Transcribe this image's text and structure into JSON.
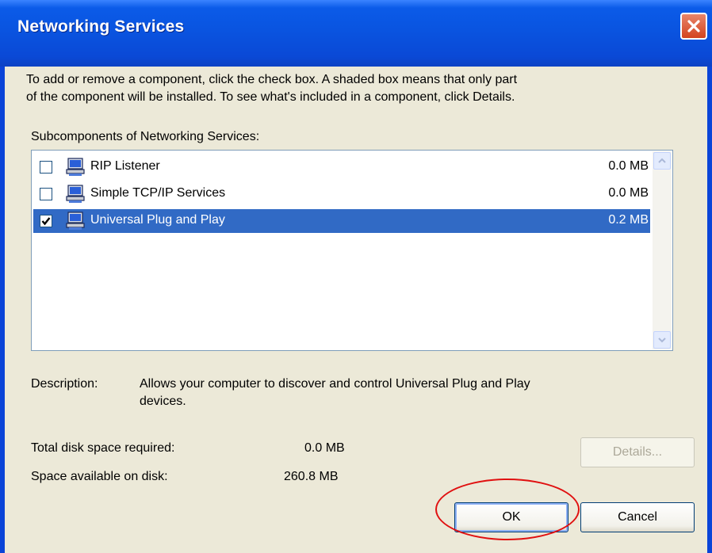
{
  "window": {
    "title": "Networking Services"
  },
  "intro": {
    "line1": "To add or remove a component, click the check box. A shaded box means that only part",
    "line2": "of the component will be installed. To see what's included in a component, click Details."
  },
  "list": {
    "label": "Subcomponents of Networking Services:",
    "items": [
      {
        "name": "RIP Listener",
        "size": "0.0 MB",
        "checked": false,
        "selected": false,
        "icon": "network-computer-icon"
      },
      {
        "name": "Simple TCP/IP Services",
        "size": "0.0 MB",
        "checked": false,
        "selected": false,
        "icon": "network-computer-icon"
      },
      {
        "name": "Universal Plug and Play",
        "size": "0.2 MB",
        "checked": true,
        "selected": true,
        "icon": "network-computer-icon"
      }
    ]
  },
  "description": {
    "label": "Description:",
    "line1": "Allows your computer to discover and control Universal Plug and Play",
    "line2": "devices."
  },
  "disk": {
    "required_label": "Total disk space required:",
    "required_value": "0.0 MB",
    "available_label": "Space available on disk:",
    "available_value": "260.8 MB"
  },
  "buttons": {
    "details": "Details...",
    "ok": "OK",
    "cancel": "Cancel"
  },
  "colors": {
    "titlebar": "#0a54e0",
    "selection": "#316ac5",
    "face": "#ece9d8",
    "highlight_circle": "#e01010"
  }
}
